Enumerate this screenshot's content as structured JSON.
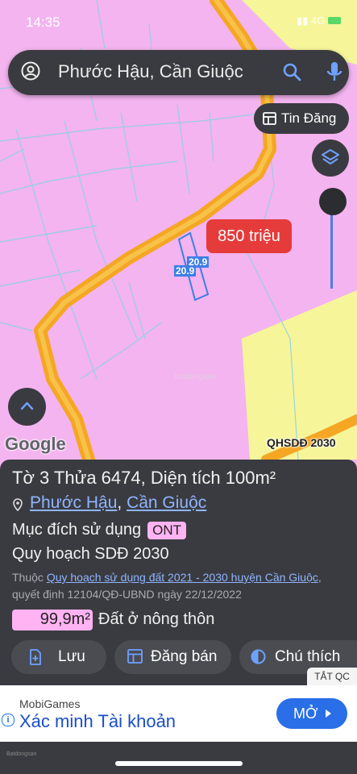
{
  "status_bar": {
    "time": "14:35",
    "network": "4G"
  },
  "search": {
    "query": "Phước Hậu, Cần Giuộc"
  },
  "map": {
    "tin_dang_label": "Tin Đăng",
    "price_tag": "850 triệu",
    "dim_top": "20.9",
    "dim_bottom": "20.9",
    "google_logo": "Google",
    "layer_label": "QHSDĐ 2030",
    "colors": {
      "residential": "#f3b4ef",
      "agricultural": "#f6f59a",
      "road": "#f5a623"
    }
  },
  "parcel": {
    "title": "Tờ 3 Thửa 6474, Diện tích 100m²",
    "location_commune": "Phước Hậu",
    "location_separator": ",",
    "location_district": "Cần Giuộc",
    "purpose_label": "Mục đích sử dụng",
    "purpose_code": "ONT",
    "plan_label": "Quy hoạch SDĐ 2030",
    "plan_note_prefix": "Thuộc",
    "plan_link": "Quy hoạch sử dụng đất 2021 - 2030 huyện Cần Giuộc",
    "plan_decision": ", quyết định 12104/QĐ-UBND ngày 22/12/2022",
    "area_value": "99,9m²",
    "area_desc": "Đất ở nông thôn"
  },
  "actions": {
    "save": "Lưu",
    "sell": "Đăng bán",
    "legend": "Chú thích"
  },
  "ad": {
    "hide_label": "TẮT QC",
    "brand": "MobiGames",
    "title": "Xác minh Tài khoản",
    "cta": "MỞ"
  },
  "footer_logo": "Batdongsan"
}
